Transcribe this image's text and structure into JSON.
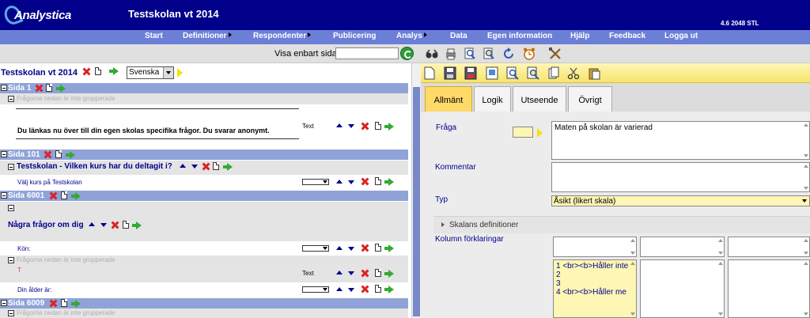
{
  "header": {
    "logo_text": "Analystica",
    "title": "Testskolan vt 2014",
    "version": "4.6 2048 STL"
  },
  "nav": [
    {
      "label": "Start",
      "submenu": false
    },
    {
      "label": "Definitioner",
      "submenu": true
    },
    {
      "label": "Respondenter",
      "submenu": true
    },
    {
      "label": "Publicering",
      "submenu": false
    },
    {
      "label": "Analys",
      "submenu": true
    },
    {
      "label": "Data",
      "submenu": false
    },
    {
      "label": "Egen information",
      "submenu": false
    },
    {
      "label": "Hjälp",
      "submenu": false
    },
    {
      "label": "Feedback",
      "submenu": false
    },
    {
      "label": "Logga ut",
      "submenu": false
    }
  ],
  "toolbar": {
    "visa_label": "Visa enbart sida",
    "visa_value": ""
  },
  "left": {
    "survey_title": "Testskolan vt 2014",
    "language": "Svenska",
    "pages": [
      {
        "label": "Sida 1"
      },
      {
        "label": "Sida 101"
      },
      {
        "label": "Sida 6001"
      },
      {
        "label": "Sida 6009"
      }
    ],
    "hint_ungrouped": "Frågorna nedan är inte grupperade",
    "info_text": "Du länkas nu över till din egen skolas specifika frågor. Du svarar anonymt.",
    "info_type": "Text",
    "group1_title": "Testskolan - Vilken kurs har du deltagit i?",
    "q_valj_kurs": "Välj kurs på Testskolan",
    "group2_title": "Några frågor om dig",
    "q_kon": "Kön:",
    "q_t": "T",
    "q_t_type": "Text",
    "q_alder": "Din ålder är:"
  },
  "right": {
    "tabs": [
      "Allmänt",
      "Logik",
      "Utseende",
      "Övrigt"
    ],
    "active_tab": "Allmänt",
    "fraga_label": "Fråga",
    "fraga_value": "Maten på skolan är varierad",
    "kommentar_label": "Kommentar",
    "kommentar_value": "",
    "typ_label": "Typ",
    "typ_value": "Åsikt (likert skala)",
    "skalans_label": "Skalans definitioner",
    "kolumn_label": "Kolumn förklaringar",
    "scale_lines": [
      "1 <br><b>Håller inte",
      "2",
      "3",
      "4 <br><b>Håller me"
    ]
  },
  "colors": {
    "header_bg": "#00008b",
    "nav_bg": "#6b7fd7",
    "page_bar": "#8fa3d9",
    "active_tab": "#ffda68",
    "accent_yellow": "#f5e20e"
  }
}
